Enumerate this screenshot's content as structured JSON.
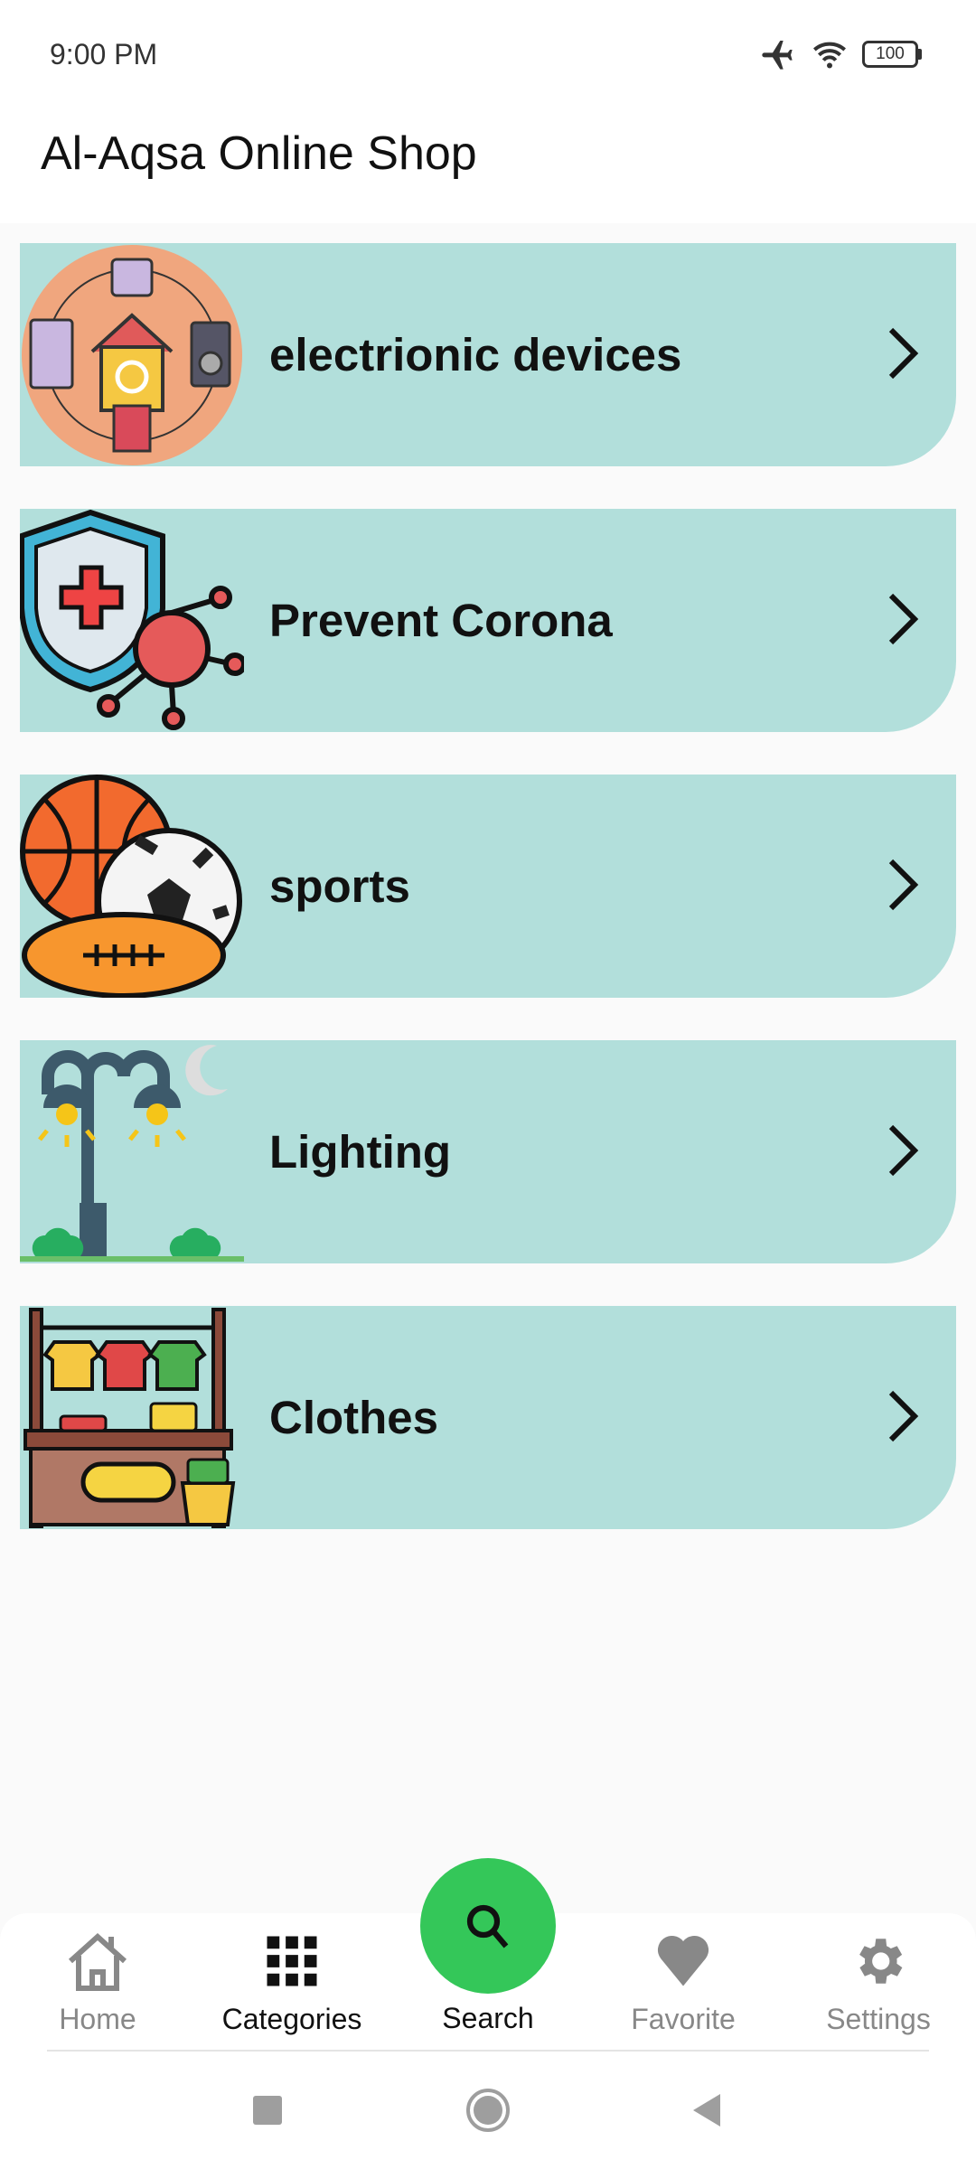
{
  "status_bar": {
    "time": "9:00 PM",
    "battery": "100",
    "icons": [
      "airplane-icon",
      "wifi-icon",
      "battery-icon"
    ]
  },
  "app_bar": {
    "title": "Al-Aqsa Online Shop"
  },
  "categories": [
    {
      "label": "electrionic devices",
      "icon": "electronic-devices-icon"
    },
    {
      "label": "Prevent Corona",
      "icon": "shield-virus-icon"
    },
    {
      "label": "sports",
      "icon": "balls-icon"
    },
    {
      "label": "Lighting",
      "icon": "street-lamp-icon"
    },
    {
      "label": "Clothes",
      "icon": "clothes-stall-icon"
    }
  ],
  "bottom_nav": {
    "items": [
      {
        "label": "Home",
        "icon": "home-icon"
      },
      {
        "label": "Categories",
        "icon": "grid-icon",
        "active": true
      },
      {
        "label": "Search",
        "icon": "search-icon"
      },
      {
        "label": "Favorite",
        "icon": "heart-icon"
      },
      {
        "label": "Settings",
        "icon": "gear-icon"
      }
    ]
  },
  "colors": {
    "card": "#b2dfdb",
    "fab": "#34c759",
    "inactive": "#888888"
  }
}
